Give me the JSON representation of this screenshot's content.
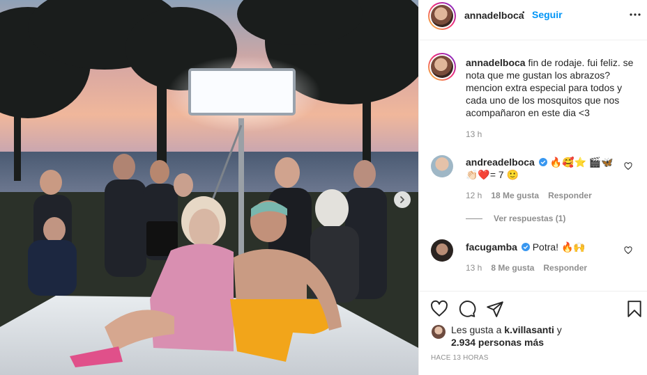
{
  "post": {
    "author": "annadelboca",
    "follow_label": "Seguir",
    "separator": "•",
    "more_label": "•••"
  },
  "caption": {
    "username": "annadelboca",
    "text": "fin de rodaje. fui feliz. se nota que me gustan los abrazos? mencion extra especial para todos y cada uno de los mosquitos que nos acompañaron en este dia <3",
    "time": "13 h"
  },
  "comments": [
    {
      "username": "andreadelboca",
      "verified": true,
      "text": "🔥🥰⭐ 🎬🦋 👏🏻❤️= 7 🙂",
      "time": "12 h",
      "likes": "18 Me gusta",
      "reply_label": "Responder",
      "view_replies": "Ver respuestas (1)"
    },
    {
      "username": "facugamba",
      "verified": true,
      "text": "Potra! 🔥🙌",
      "time": "13 h",
      "likes": "8 Me gusta",
      "reply_label": "Responder"
    }
  ],
  "likes": {
    "prefix": "Les gusta a ",
    "first_user": "k.villasanti",
    "middle": " y",
    "others": "2.934 personas más"
  },
  "timestamp": "HACE 13 HORAS",
  "colors": {
    "follow_blue": "#0095f6",
    "verified_blue": "#3897f0",
    "meta_gray": "#8e8e8e",
    "text": "#262626"
  },
  "icons": {
    "like": "heart-icon",
    "comment": "comment-icon",
    "share": "share-icon",
    "save": "bookmark-icon",
    "more": "more-options-icon",
    "next": "chevron-right-icon",
    "verified": "verified-badge-icon"
  }
}
